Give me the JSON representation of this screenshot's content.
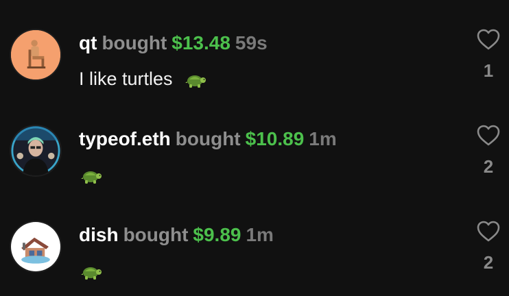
{
  "feed": [
    {
      "username": "qt",
      "action": "bought",
      "amount": "$13.48",
      "time": "59s",
      "message": "I like turtles",
      "emoji": "turtle-emoji",
      "likes": "1",
      "avatar_bg": "#f5a06e"
    },
    {
      "username": "typeof.eth",
      "action": "bought",
      "amount": "$10.89",
      "time": "1m",
      "message": "",
      "emoji": "turtle-emoji",
      "likes": "2",
      "avatar_bg": "#2a2a35"
    },
    {
      "username": "dish",
      "action": "bought",
      "amount": "$9.89",
      "time": "1m",
      "message": "",
      "emoji": "turtle-emoji",
      "likes": "2",
      "avatar_bg": "#ffffff"
    }
  ],
  "colors": {
    "background": "#111111",
    "username": "#ffffff",
    "action": "#8e8e8e",
    "amount": "#4cc04c",
    "time": "#7a7a7a",
    "like_icon": "#8a8a8a"
  },
  "icons": {
    "like": "heart-outline-icon",
    "emoji": "turtle-emoji"
  }
}
